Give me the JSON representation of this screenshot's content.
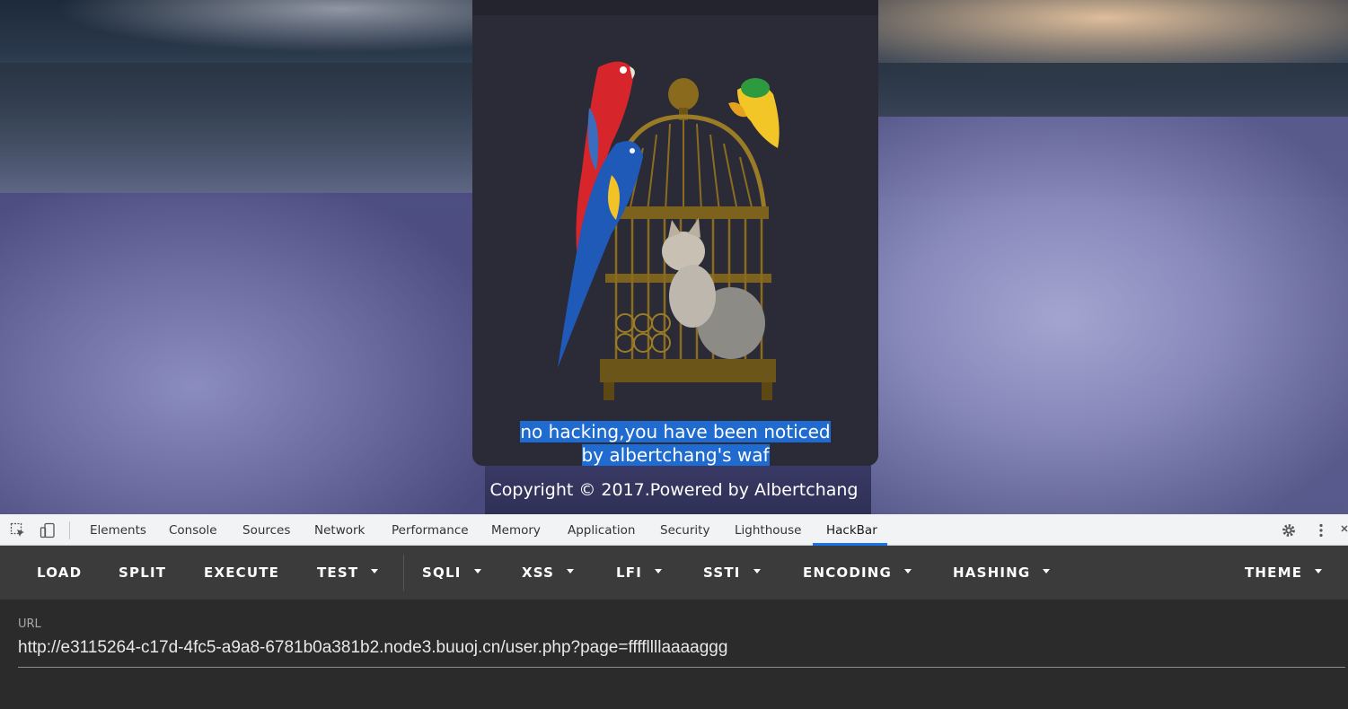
{
  "page": {
    "waf_message": "no hacking,you have been noticed by albertchang's waf",
    "copyright": "Copyright © 2017.Powered by Albertchang"
  },
  "devtools": {
    "tabs": [
      {
        "label": "Elements"
      },
      {
        "label": "Console"
      },
      {
        "label": "Sources"
      },
      {
        "label": "Network"
      },
      {
        "label": "Performance"
      },
      {
        "label": "Memory"
      },
      {
        "label": "Application"
      },
      {
        "label": "Security"
      },
      {
        "label": "Lighthouse"
      },
      {
        "label": "HackBar"
      }
    ],
    "active_tab": "HackBar",
    "accent_color": "#1a73e8"
  },
  "hackbar": {
    "menu": [
      {
        "label": "LOAD"
      },
      {
        "label": "SPLIT"
      },
      {
        "label": "EXECUTE"
      },
      {
        "label": "TEST"
      },
      {
        "label": "SQLI"
      },
      {
        "label": "XSS"
      },
      {
        "label": "LFI"
      },
      {
        "label": "SSTI"
      },
      {
        "label": "ENCODING"
      },
      {
        "label": "HASHING"
      },
      {
        "label": "THEME"
      }
    ],
    "url_label": "URL",
    "url_value": "http://e3115264-c17d-4fc5-a9a8-6781b0a381b2.node3.buuoj.cn/user.php?page=ffffllllaaaaggg"
  },
  "colors": {
    "selection_highlight": "#1f6bd0",
    "card_background": "#2a2b36",
    "hackbar_menu_bg": "#3b3b3b"
  }
}
